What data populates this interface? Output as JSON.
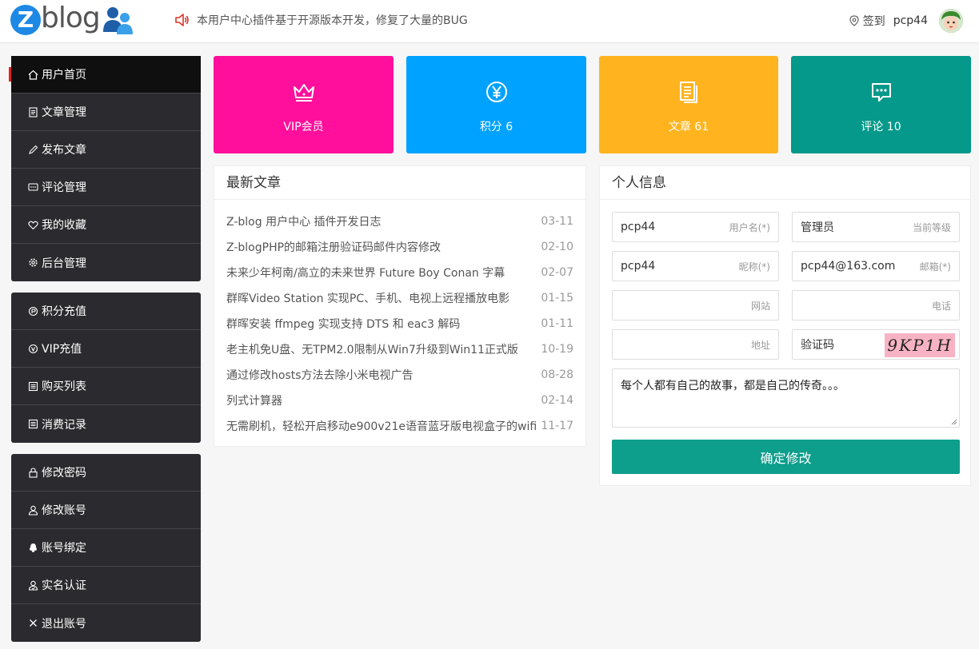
{
  "header": {
    "logo_letter": "Z",
    "logo_text": "blog",
    "notice": "本用户中心插件基于开源版本开发，修复了大量的BUG",
    "signin_label": "签到",
    "username": "pcp44"
  },
  "sidebar": {
    "group1": [
      {
        "label": "用户首页",
        "icon": "home-icon"
      },
      {
        "label": "文章管理",
        "icon": "document-icon"
      },
      {
        "label": "发布文章",
        "icon": "pencil-icon"
      },
      {
        "label": "评论管理",
        "icon": "comment-icon"
      },
      {
        "label": "我的收藏",
        "icon": "heart-icon"
      },
      {
        "label": "后台管理",
        "icon": "gear-icon"
      }
    ],
    "group2": [
      {
        "label": "积分充值",
        "icon": "points-icon"
      },
      {
        "label": "VIP充值",
        "icon": "vip-icon"
      },
      {
        "label": "购买列表",
        "icon": "list-icon"
      },
      {
        "label": "消费记录",
        "icon": "record-icon"
      }
    ],
    "group3": [
      {
        "label": "修改密码",
        "icon": "lock-icon"
      },
      {
        "label": "修改账号",
        "icon": "user-icon"
      },
      {
        "label": "账号绑定",
        "icon": "qq-icon"
      },
      {
        "label": "实名认证",
        "icon": "id-icon"
      },
      {
        "label": "退出账号",
        "icon": "close-icon"
      }
    ]
  },
  "cards": [
    {
      "label": "VIP会员",
      "icon": "crown-icon",
      "color": "#ff0f9b"
    },
    {
      "label": "积分 6",
      "icon": "yen-icon",
      "color": "#00a2ff"
    },
    {
      "label": "文章 61",
      "icon": "articles-icon",
      "color": "#ffb41f"
    },
    {
      "label": "评论 10",
      "icon": "comment-icon",
      "color": "#04998a"
    }
  ],
  "latest": {
    "title": "最新文章",
    "articles": [
      {
        "title": "Z-blog 用户中心 插件开发日志",
        "date": "03-11"
      },
      {
        "title": "Z-blogPHP的邮箱注册验证码邮件内容修改",
        "date": "02-10"
      },
      {
        "title": "未来少年柯南/高立的未来世界 Future Boy Conan 字幕",
        "date": "02-07"
      },
      {
        "title": "群晖Video Station 实现PC、手机、电视上远程播放电影",
        "date": "01-15"
      },
      {
        "title": "群晖安装 ffmpeg 实现支持 DTS 和 eac3 解码",
        "date": "01-11"
      },
      {
        "title": "老主机免U盘、无TPM2.0限制从Win7升级到Win11正式版",
        "date": "10-19"
      },
      {
        "title": "通过修改hosts方法去除小米电视广告",
        "date": "08-28"
      },
      {
        "title": "列式计算器",
        "date": "02-14"
      },
      {
        "title": "无需刷机，轻松开启移动e900v21e语音蓝牙版电视盒子的wifi",
        "date": "11-17"
      }
    ]
  },
  "profile": {
    "title": "个人信息",
    "username": {
      "value": "pcp44",
      "hint": "用户名(*)"
    },
    "level": {
      "value": "管理员",
      "hint": "当前等级"
    },
    "nickname": {
      "value": "pcp44",
      "hint": "昵称(*)"
    },
    "email": {
      "value": "pcp44@163.com",
      "hint": "邮箱(*)"
    },
    "website": {
      "value": "",
      "hint": "网站"
    },
    "phone": {
      "value": "",
      "hint": "电话"
    },
    "address": {
      "value": "",
      "hint": "地址"
    },
    "captcha": {
      "label": "验证码",
      "image_text": "9KP1H"
    },
    "bio": "每个人都有自己的故事，都是自己的传奇。。。",
    "submit_label": "确定修改"
  }
}
